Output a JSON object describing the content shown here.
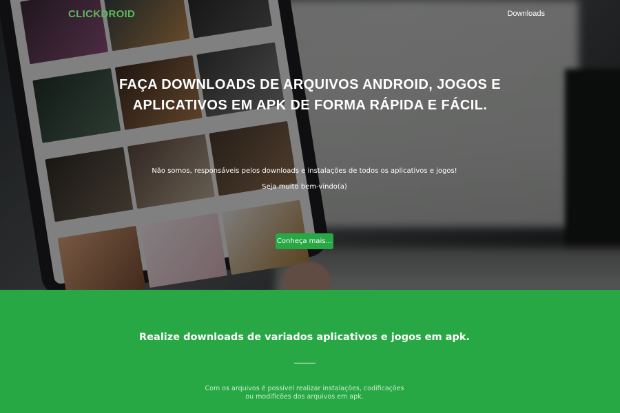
{
  "navbar": {
    "brand": "CLICKDROID",
    "links": [
      {
        "label": "Downloads"
      }
    ]
  },
  "hero": {
    "headline_line1": "FAÇA DOWNLOADS DE ARQUIVOS ANDROID, JOGOS E",
    "headline_line2": "APLICATIVOS EM APK DE FORMA RÁPIDA E FÁCIL.",
    "disclaimer": "Não somos, responsáveis pelos downloads e instalações de todos os aplicativos e jogos!",
    "welcome": "Seja muito bem-vindo(a)",
    "cta_label": "Conheça mais..."
  },
  "about": {
    "title": "Realize downloads de variados aplicativos e jogos em apk.",
    "text_line1": "Com os arquivos é possível realizar instalações, codificações",
    "text_line2": "ou modificões dos arquivos em apk."
  },
  "colors": {
    "brand": "#5cb85c",
    "accent": "#28a745",
    "text_light": "#ffffff"
  }
}
